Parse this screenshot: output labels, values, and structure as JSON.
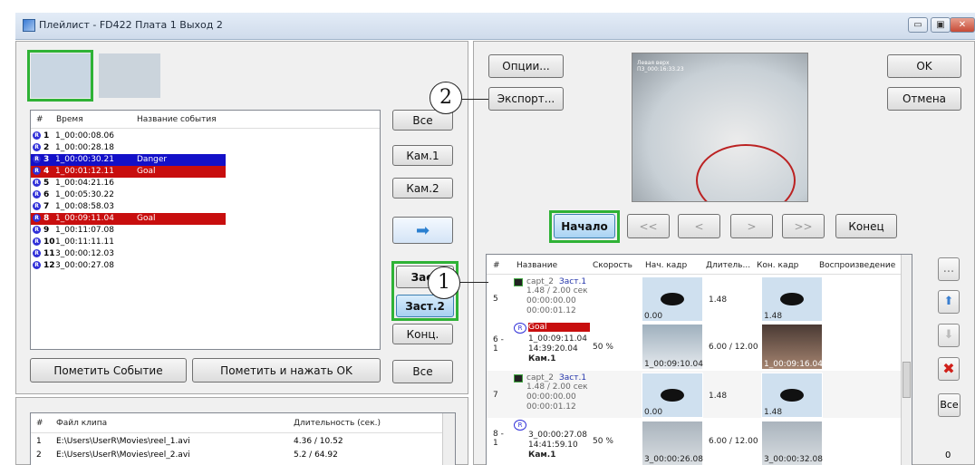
{
  "window": {
    "title": "Плейлист - FD422 Плата 1 Выход 2",
    "min": "▭",
    "max": "▣",
    "close": "✕"
  },
  "events": {
    "columns": [
      "#",
      "Время",
      "Название события"
    ],
    "rows": [
      {
        "num": "1",
        "time": "1_00:00:08.06",
        "name": "",
        "style": "normal"
      },
      {
        "num": "2",
        "time": "1_00:00:28.18",
        "name": "",
        "style": "normal"
      },
      {
        "num": "3",
        "time": "1_00:00:30.21",
        "name": "Danger",
        "style": "blue"
      },
      {
        "num": "4",
        "time": "1_00:01:12.11",
        "name": "Goal",
        "style": "red"
      },
      {
        "num": "5",
        "time": "1_00:04:21.16",
        "name": "",
        "style": "normal"
      },
      {
        "num": "6",
        "time": "1_00:05:30.22",
        "name": "",
        "style": "normal"
      },
      {
        "num": "7",
        "time": "1_00:08:58.03",
        "name": "",
        "style": "normal"
      },
      {
        "num": "8",
        "time": "1_00:09:11.04",
        "name": "Goal",
        "style": "red"
      },
      {
        "num": "9",
        "time": "1_00:11:07.08",
        "name": "",
        "style": "normal"
      },
      {
        "num": "10",
        "time": "1_00:11:11.11",
        "name": "",
        "style": "normal"
      },
      {
        "num": "11",
        "time": "3_00:00:12.03",
        "name": "",
        "style": "normal"
      },
      {
        "num": "12",
        "time": "3_00:00:27.08",
        "name": "",
        "style": "normal"
      }
    ]
  },
  "left_buttons": {
    "all_top": "Все",
    "cam1": "Кам.1",
    "cam2": "Кам.2",
    "zast1": "Заст",
    "zast2": "Заст.2",
    "konc": "Конц.",
    "all_bottom": "Все",
    "mark_event": "Пометить Событие",
    "mark_ok": "Пометить и нажать OK"
  },
  "clips": {
    "columns": [
      "#",
      "Файл клипа",
      "Длительность (сек.)"
    ],
    "rows": [
      {
        "num": "1",
        "file": "E:\\Users\\UserR\\Movies\\reel_1.avi",
        "dur": "4.36 / 10.52"
      },
      {
        "num": "2",
        "file": "E:\\Users\\UserR\\Movies\\reel_2.avi",
        "dur": "5.2 / 64.92"
      }
    ]
  },
  "right": {
    "options": "Опции...",
    "export": "Экспорт...",
    "ok": "OK",
    "cancel": "Отмена",
    "preview_text": "Левая верх\nПЗ_000:16:33.23",
    "nav": {
      "start": "Начало",
      "prev2": "<<",
      "prev": "<",
      "next": ">",
      "next2": ">>",
      "end": "Конец"
    },
    "columns": [
      "#",
      "Название",
      "Скорость",
      "Нач. кадр",
      "Длитель...",
      "Кон. кадр",
      "Воспроизведение"
    ],
    "rows": [
      {
        "num": "5",
        "name": "capt_2",
        "tag": "Заст.1",
        "line1": "1.48 / 2.00 сек",
        "line2": "00:00:00.00",
        "line3": "00:00:01.12",
        "speed": "",
        "start_lbl": "0.00",
        "dur": "1.48",
        "end_lbl": "1.48"
      },
      {
        "num": "6 - 1",
        "name": "Goal",
        "tag": "",
        "line1": "1_00:09:11.04",
        "line2": "14:39:20.04",
        "line3": "Кам.1",
        "speed": "50 %",
        "start_lbl": "1_00:09:10.04",
        "dur": "6.00 / 12.00",
        "end_lbl": "1_00:09:16.04"
      },
      {
        "num": "7",
        "name": "capt_2",
        "tag": "Заст.1",
        "line1": "1.48 / 2.00 сек",
        "line2": "00:00:00.00",
        "line3": "00:00:01.12",
        "speed": "",
        "start_lbl": "0.00",
        "dur": "1.48",
        "end_lbl": "1.48"
      },
      {
        "num": "8 - 1",
        "name": "",
        "tag": "",
        "line1": "3_00:00:27.08",
        "line2": "14:41:59.10",
        "line3": "Кам.1",
        "speed": "50 %",
        "start_lbl": "3_00:00:26.08",
        "dur": "6.00 / 12.00",
        "end_lbl": "3_00:00:32.08"
      }
    ],
    "side": {
      "more": "...",
      "up": "⬆",
      "down": "⬇",
      "delete": "✖",
      "all": "Все",
      "count": "0"
    }
  },
  "callouts": {
    "one": "1",
    "two": "2"
  },
  "colors": {
    "highlight": "#2fb236",
    "blue_row": "#1310c8",
    "red_row": "#c80e0e"
  }
}
